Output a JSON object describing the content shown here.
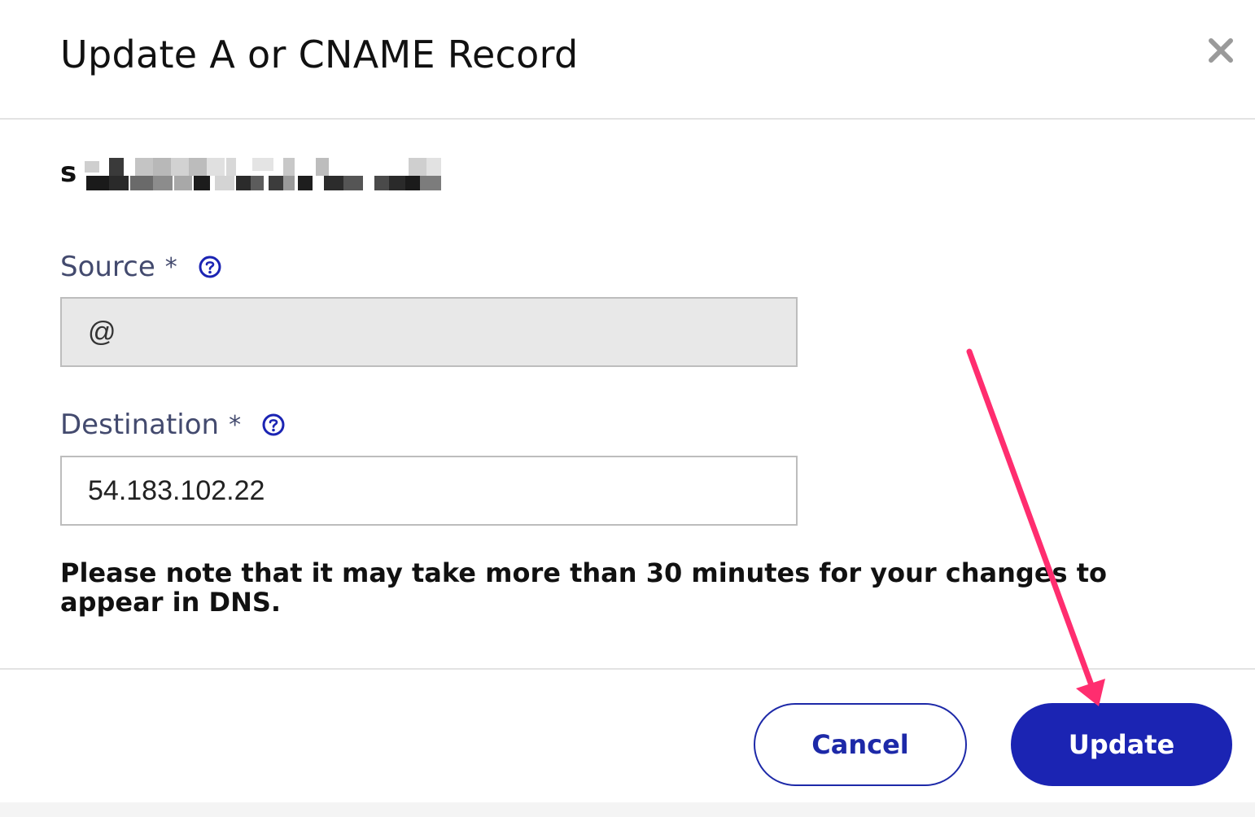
{
  "modal": {
    "title": "Update A or CNAME Record",
    "domain_visible_prefix": "s"
  },
  "fields": {
    "source": {
      "label": "Source",
      "required_marker": "*",
      "value": "@"
    },
    "destination": {
      "label": "Destination",
      "required_marker": "*",
      "value": "54.183.102.22"
    }
  },
  "note": "Please note that it may take more than 30 minutes for your changes to appear in DNS.",
  "buttons": {
    "cancel": "Cancel",
    "update": "Update"
  },
  "icons": {
    "close": "close-icon",
    "help": "question-circle-icon"
  },
  "colors": {
    "primary": "#1b24b3",
    "label": "#434a6e",
    "annotation_arrow": "#ff2d6f",
    "disabled_input_bg": "#e8e8e8"
  }
}
